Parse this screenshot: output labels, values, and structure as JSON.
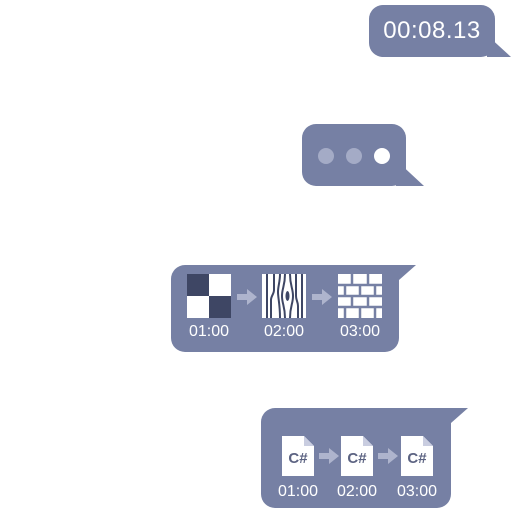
{
  "colors": {
    "bubble": "#7680a4",
    "dot_dim": "#a4abc6",
    "dot_bright": "#ffffff",
    "arrow": "#aeb4cd",
    "tile_dark": "#3e4664",
    "tile_light": "#ffffff"
  },
  "timer_bubble": {
    "time": "00:08.13"
  },
  "typing_bubble": {
    "dots": [
      "dim",
      "dim",
      "bright"
    ]
  },
  "textures_bubble": {
    "steps": [
      {
        "icon": "checkerboard-texture-icon",
        "time": "01:00"
      },
      {
        "icon": "wood-grain-texture-icon",
        "time": "02:00"
      },
      {
        "icon": "brick-wall-texture-icon",
        "time": "03:00"
      }
    ]
  },
  "scripts_bubble": {
    "steps": [
      {
        "icon": "csharp-file-icon",
        "label": "C#",
        "time": "01:00"
      },
      {
        "icon": "csharp-file-icon",
        "label": "C#",
        "time": "02:00"
      },
      {
        "icon": "csharp-file-icon",
        "label": "C#",
        "time": "03:00"
      }
    ]
  }
}
